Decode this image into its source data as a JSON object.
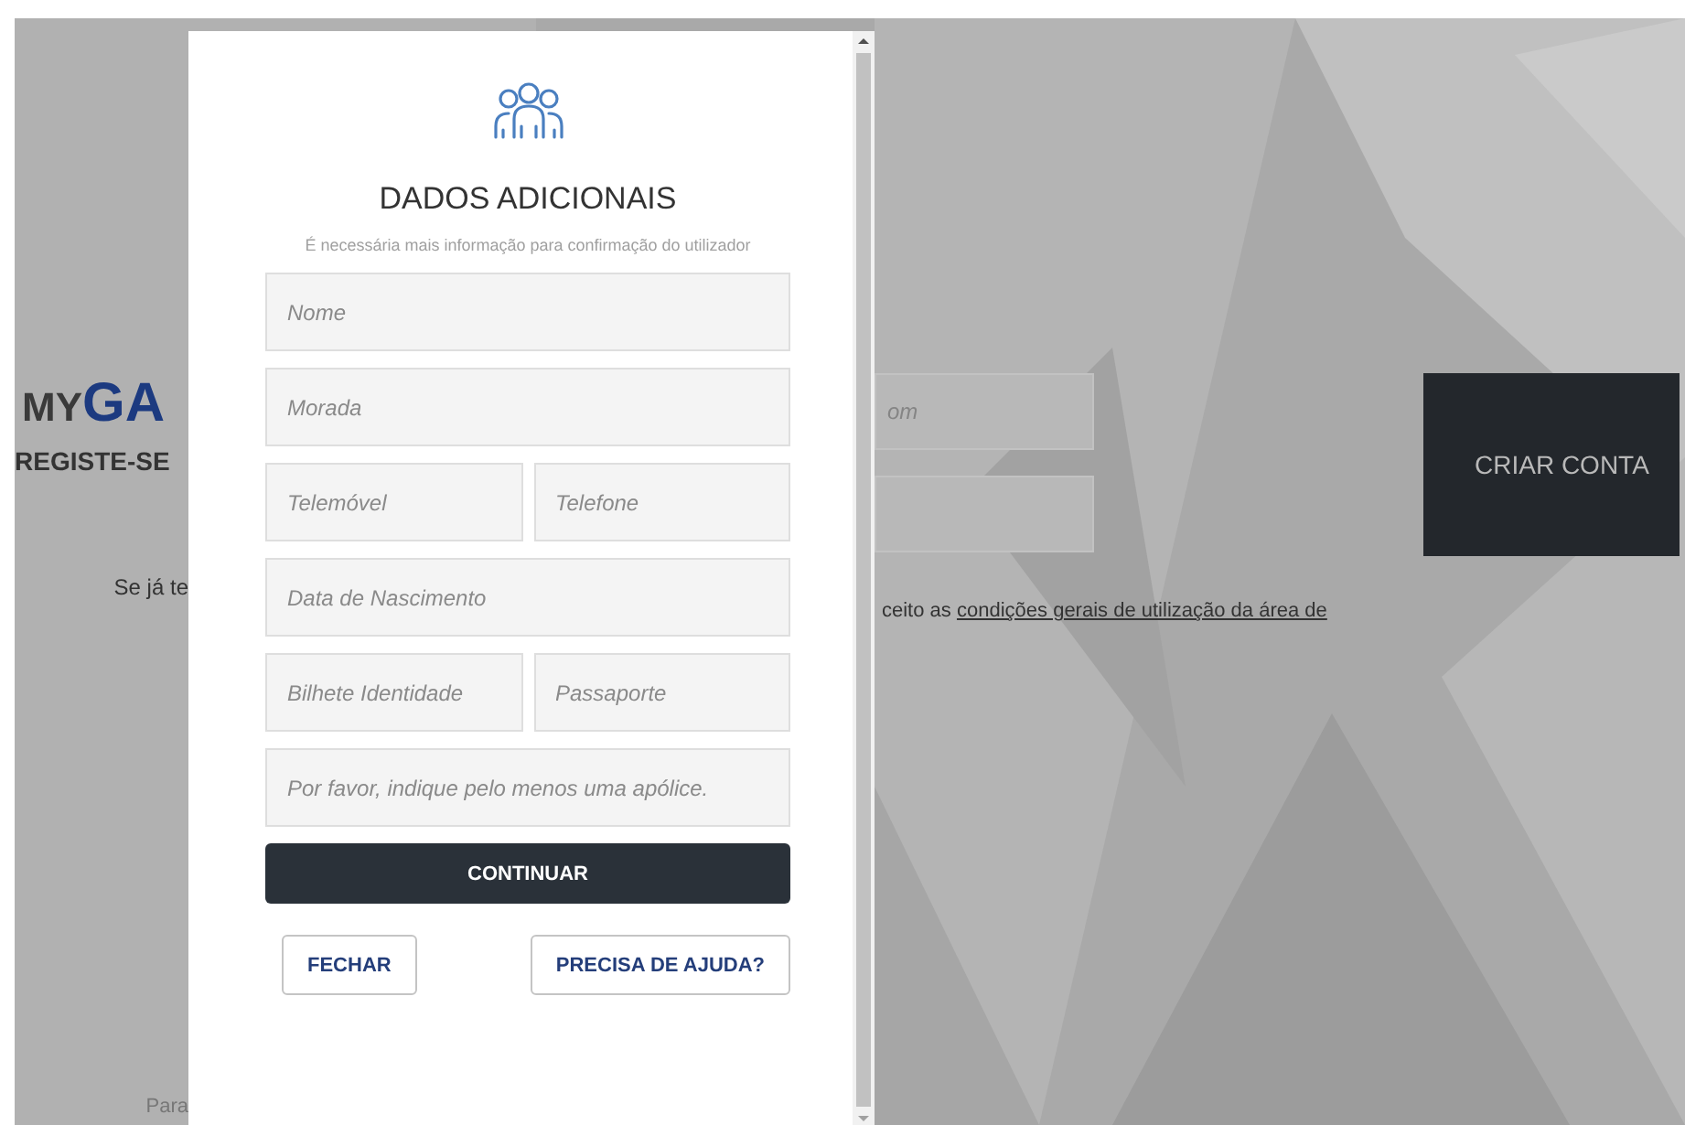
{
  "background_page": {
    "logo": {
      "prefix": "MY",
      "brand": "GA"
    },
    "heading": "REGISTE-SE",
    "login_prompt": "Se já te",
    "fields": [
      {
        "placeholder": "om"
      }
    ],
    "terms": {
      "text": "ceito as",
      "link": "condições gerais de utilização da área de"
    },
    "footer_text": "Para",
    "create_button": "CRIAR CONTA"
  },
  "modal": {
    "title": "DADOS ADICIONAIS",
    "subtitle": "É necessária mais informação para confirmação do utilizador",
    "rows": [
      [
        {
          "placeholder": "Nome"
        }
      ],
      [
        {
          "placeholder": "Morada"
        }
      ],
      [
        {
          "placeholder": "Telemóvel"
        },
        {
          "placeholder": "Telefone"
        }
      ],
      [
        {
          "placeholder": "Data de Nascimento"
        }
      ],
      [
        {
          "placeholder": "Bilhete Identidade"
        },
        {
          "placeholder": "Passaporte"
        }
      ],
      [
        {
          "placeholder": "Por favor, indique pelo menos uma apólice."
        }
      ]
    ],
    "continue_button": "CONTINUAR",
    "close_button": "FECHAR",
    "help_button": "PRECISA DE AJUDA?"
  }
}
